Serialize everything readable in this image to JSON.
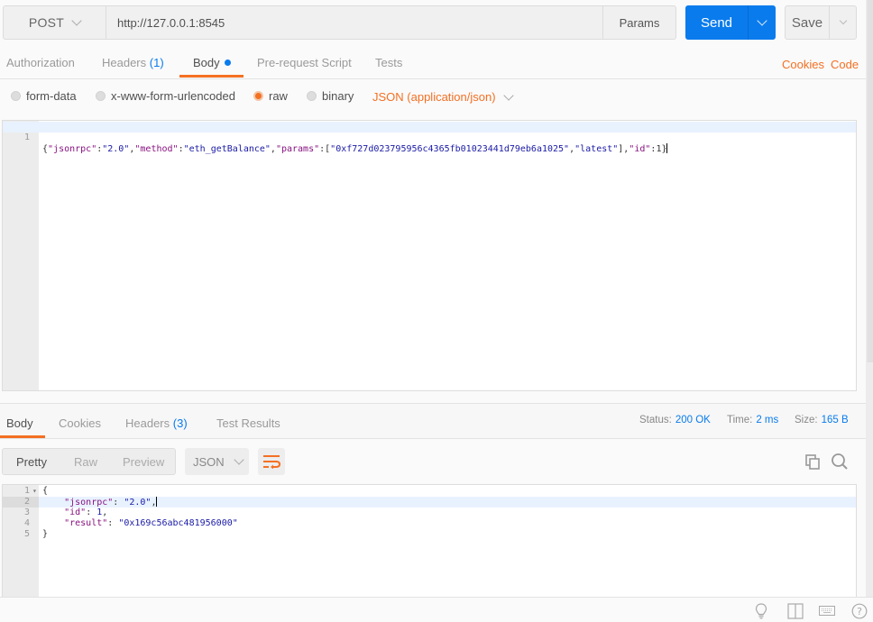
{
  "request": {
    "method": "POST",
    "url": "http://127.0.0.1:8545",
    "params_label": "Params",
    "send_label": "Send",
    "save_label": "Save"
  },
  "request_tabs": {
    "authorization": "Authorization",
    "headers": "Headers",
    "headers_count": "(1)",
    "body": "Body",
    "pre_request": "Pre-request Script",
    "tests": "Tests",
    "cookies": "Cookies",
    "code": "Code"
  },
  "body_types": {
    "form_data": "form-data",
    "urlencoded": "x-www-form-urlencoded",
    "raw": "raw",
    "binary": "binary",
    "selected": "raw",
    "content_type": "JSON (application/json)"
  },
  "request_body": {
    "line_number": "1",
    "tokens": [
      {
        "t": "p",
        "v": "{"
      },
      {
        "t": "k",
        "v": "\"jsonrpc\""
      },
      {
        "t": "p",
        "v": ":"
      },
      {
        "t": "s",
        "v": "\"2.0\""
      },
      {
        "t": "p",
        "v": ","
      },
      {
        "t": "k",
        "v": "\"method\""
      },
      {
        "t": "p",
        "v": ":"
      },
      {
        "t": "s",
        "v": "\"eth_getBalance\""
      },
      {
        "t": "p",
        "v": ","
      },
      {
        "t": "k",
        "v": "\"params\""
      },
      {
        "t": "p",
        "v": ":["
      },
      {
        "t": "s",
        "v": "\"0xf727d023795956c4365fb01023441d79eb6a1025\""
      },
      {
        "t": "p",
        "v": ","
      },
      {
        "t": "s",
        "v": "\"latest\""
      },
      {
        "t": "p",
        "v": "],"
      },
      {
        "t": "k",
        "v": "\"id\""
      },
      {
        "t": "p",
        "v": ":1}"
      }
    ]
  },
  "response_tabs": {
    "body": "Body",
    "cookies": "Cookies",
    "headers": "Headers",
    "headers_count": "(3)",
    "test_results": "Test Results"
  },
  "response_meta": {
    "status_label": "Status:",
    "status_value": "200 OK",
    "time_label": "Time:",
    "time_value": "2 ms",
    "size_label": "Size:",
    "size_value": "165 B"
  },
  "response_view": {
    "pretty": "Pretty",
    "raw": "Raw",
    "preview": "Preview",
    "format": "JSON"
  },
  "response_body": {
    "lines": [
      {
        "n": "1",
        "indent": "",
        "key": "",
        "sep": "",
        "val": "",
        "valType": "",
        "tail": "{"
      },
      {
        "n": "2",
        "indent": "    ",
        "key": "\"jsonrpc\"",
        "sep": ": ",
        "val": "\"2.0\"",
        "valType": "s",
        "tail": ","
      },
      {
        "n": "3",
        "indent": "    ",
        "key": "\"id\"",
        "sep": ": ",
        "val": "1",
        "valType": "n",
        "tail": ","
      },
      {
        "n": "4",
        "indent": "    ",
        "key": "\"result\"",
        "sep": ": ",
        "val": "\"0x169c56abc481956000\"",
        "valType": "s",
        "tail": ""
      },
      {
        "n": "5",
        "indent": "",
        "key": "",
        "sep": "",
        "val": "",
        "valType": "",
        "tail": "}"
      }
    ]
  },
  "icons": {
    "copy": "copy-icon",
    "search": "search-icon",
    "bulb": "lightbulb-icon",
    "layout": "two-pane-icon",
    "keyboard": "keyboard-icon",
    "help": "help-icon"
  }
}
